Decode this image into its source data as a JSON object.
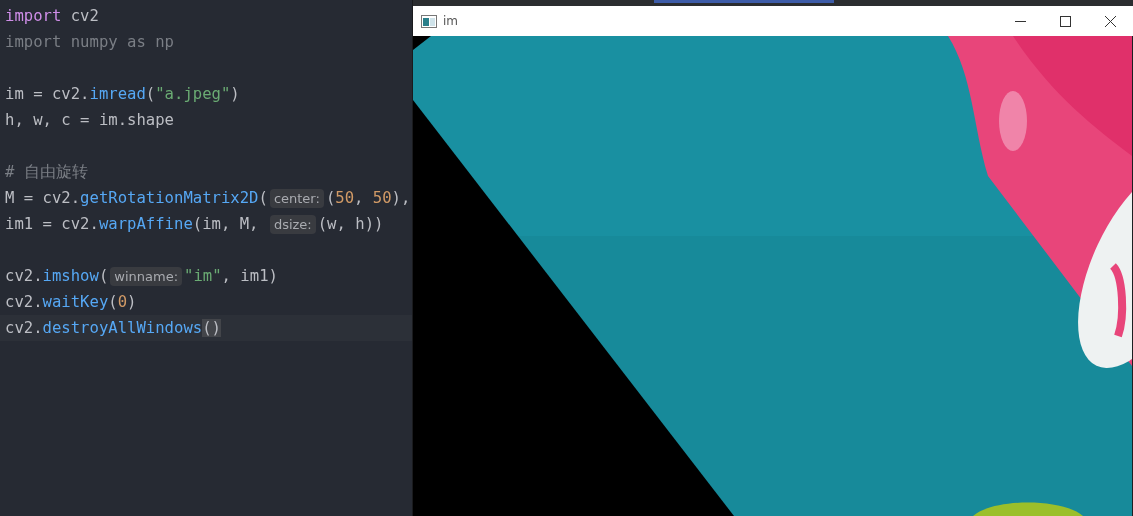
{
  "editor": {
    "lines": [
      {
        "kind": "code",
        "tokens": [
          {
            "kind": "keyword",
            "text": "import"
          },
          {
            "kind": "plain",
            "text": " cv2"
          }
        ]
      },
      {
        "kind": "code",
        "tokens": [
          {
            "kind": "dim",
            "text": "import numpy as np"
          }
        ]
      },
      {
        "kind": "blank"
      },
      {
        "kind": "code",
        "tokens": [
          {
            "kind": "plain",
            "text": "im = cv2."
          },
          {
            "kind": "func",
            "text": "imread"
          },
          {
            "kind": "plain",
            "text": "("
          },
          {
            "kind": "string",
            "text": "\"a.jpeg\""
          },
          {
            "kind": "plain",
            "text": ")"
          }
        ]
      },
      {
        "kind": "code",
        "tokens": [
          {
            "kind": "plain",
            "text": "h, w, c = im.shape"
          }
        ]
      },
      {
        "kind": "blank"
      },
      {
        "kind": "code",
        "tokens": [
          {
            "kind": "comment",
            "text": "# 自由旋转"
          }
        ]
      },
      {
        "kind": "code",
        "tokens": [
          {
            "kind": "plain",
            "text": "M = cv2."
          },
          {
            "kind": "func",
            "text": "getRotationMatrix2D"
          },
          {
            "kind": "plain",
            "text": "("
          },
          {
            "kind": "hint",
            "text": "center:"
          },
          {
            "kind": "plain",
            "text": "("
          },
          {
            "kind": "number",
            "text": "50"
          },
          {
            "kind": "plain",
            "text": ", "
          },
          {
            "kind": "number",
            "text": "50"
          },
          {
            "kind": "plain",
            "text": "), "
          }
        ]
      },
      {
        "kind": "code",
        "tokens": [
          {
            "kind": "plain",
            "text": "im1 = cv2."
          },
          {
            "kind": "func",
            "text": "warpAffine"
          },
          {
            "kind": "plain",
            "text": "(im, M, "
          },
          {
            "kind": "hint",
            "text": "dsize:"
          },
          {
            "kind": "plain",
            "text": "(w, h))"
          }
        ]
      },
      {
        "kind": "blank"
      },
      {
        "kind": "code",
        "tokens": [
          {
            "kind": "plain",
            "text": "cv2."
          },
          {
            "kind": "func",
            "text": "imshow"
          },
          {
            "kind": "plain",
            "text": "("
          },
          {
            "kind": "hint",
            "text": "winname:"
          },
          {
            "kind": "string",
            "text": "\"im\""
          },
          {
            "kind": "plain",
            "text": ", im1)"
          }
        ]
      },
      {
        "kind": "code",
        "tokens": [
          {
            "kind": "plain",
            "text": "cv2."
          },
          {
            "kind": "func",
            "text": "waitKey"
          },
          {
            "kind": "plain",
            "text": "("
          },
          {
            "kind": "number",
            "text": "0"
          },
          {
            "kind": "plain",
            "text": ")"
          }
        ]
      },
      {
        "kind": "current",
        "tokens": [
          {
            "kind": "plain",
            "text": "cv2."
          },
          {
            "kind": "func",
            "text": "destroyAllWindows"
          },
          {
            "kind": "bracket",
            "text": "()"
          }
        ]
      }
    ]
  },
  "image_window": {
    "title": "im"
  }
}
